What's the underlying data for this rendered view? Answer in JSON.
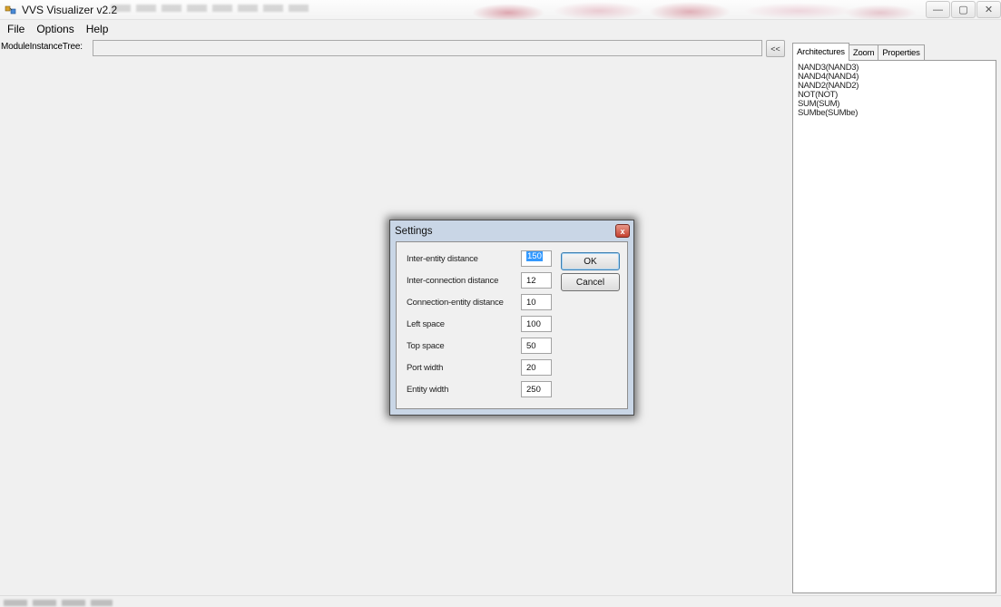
{
  "window": {
    "title": "VVS Visualizer v2.2",
    "controls": {
      "minimize": "—",
      "maximize": "▢",
      "close": "✕"
    }
  },
  "menu": {
    "items": [
      "File",
      "Options",
      "Help"
    ]
  },
  "tree": {
    "label": "ModuleInstanceTree:",
    "value": "",
    "collapse_label": "<<"
  },
  "right_panel": {
    "tabs": [
      "Architectures",
      "Zoom",
      "Properties"
    ],
    "active_tab": 0,
    "architectures": [
      "NAND3(NAND3)",
      "NAND4(NAND4)",
      "NAND2(NAND2)",
      "NOT(NOT)",
      "SUM(SUM)",
      "SUMbe(SUMbe)"
    ]
  },
  "settings_dialog": {
    "title": "Settings",
    "close_glyph": "x",
    "fields": [
      {
        "label": "Inter-entity distance",
        "value": "150"
      },
      {
        "label": "Inter-connection distance",
        "value": "12"
      },
      {
        "label": "Connection-entity distance",
        "value": "10"
      },
      {
        "label": "Left space",
        "value": "100"
      },
      {
        "label": "Top space",
        "value": "50"
      },
      {
        "label": "Port width",
        "value": "20"
      },
      {
        "label": "Entity width",
        "value": "250"
      }
    ],
    "ok_label": "OK",
    "cancel_label": "Cancel"
  },
  "colors": {
    "background": "#f0f0f0",
    "selection": "#3399ff",
    "close_button": "#c5412f"
  }
}
